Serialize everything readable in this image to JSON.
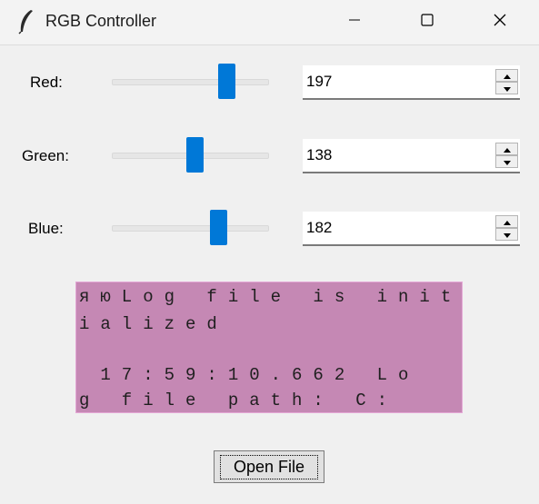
{
  "window": {
    "title": "RGB Controller"
  },
  "rows": [
    {
      "label": "Red:",
      "value": "197",
      "level": 197
    },
    {
      "label": "Green:",
      "value": "138",
      "level": 138
    },
    {
      "label": "Blue:",
      "value": "182",
      "level": 182
    }
  ],
  "log": {
    "lines": [
      "яюLog file is init",
      "ialized",
      "",
      " 17:59:10.662 Lo",
      "g file path: C:"
    ],
    "background": "#c588b4"
  },
  "open_button": {
    "label": "Open File"
  },
  "colors": {
    "accent": "#0078d7"
  }
}
